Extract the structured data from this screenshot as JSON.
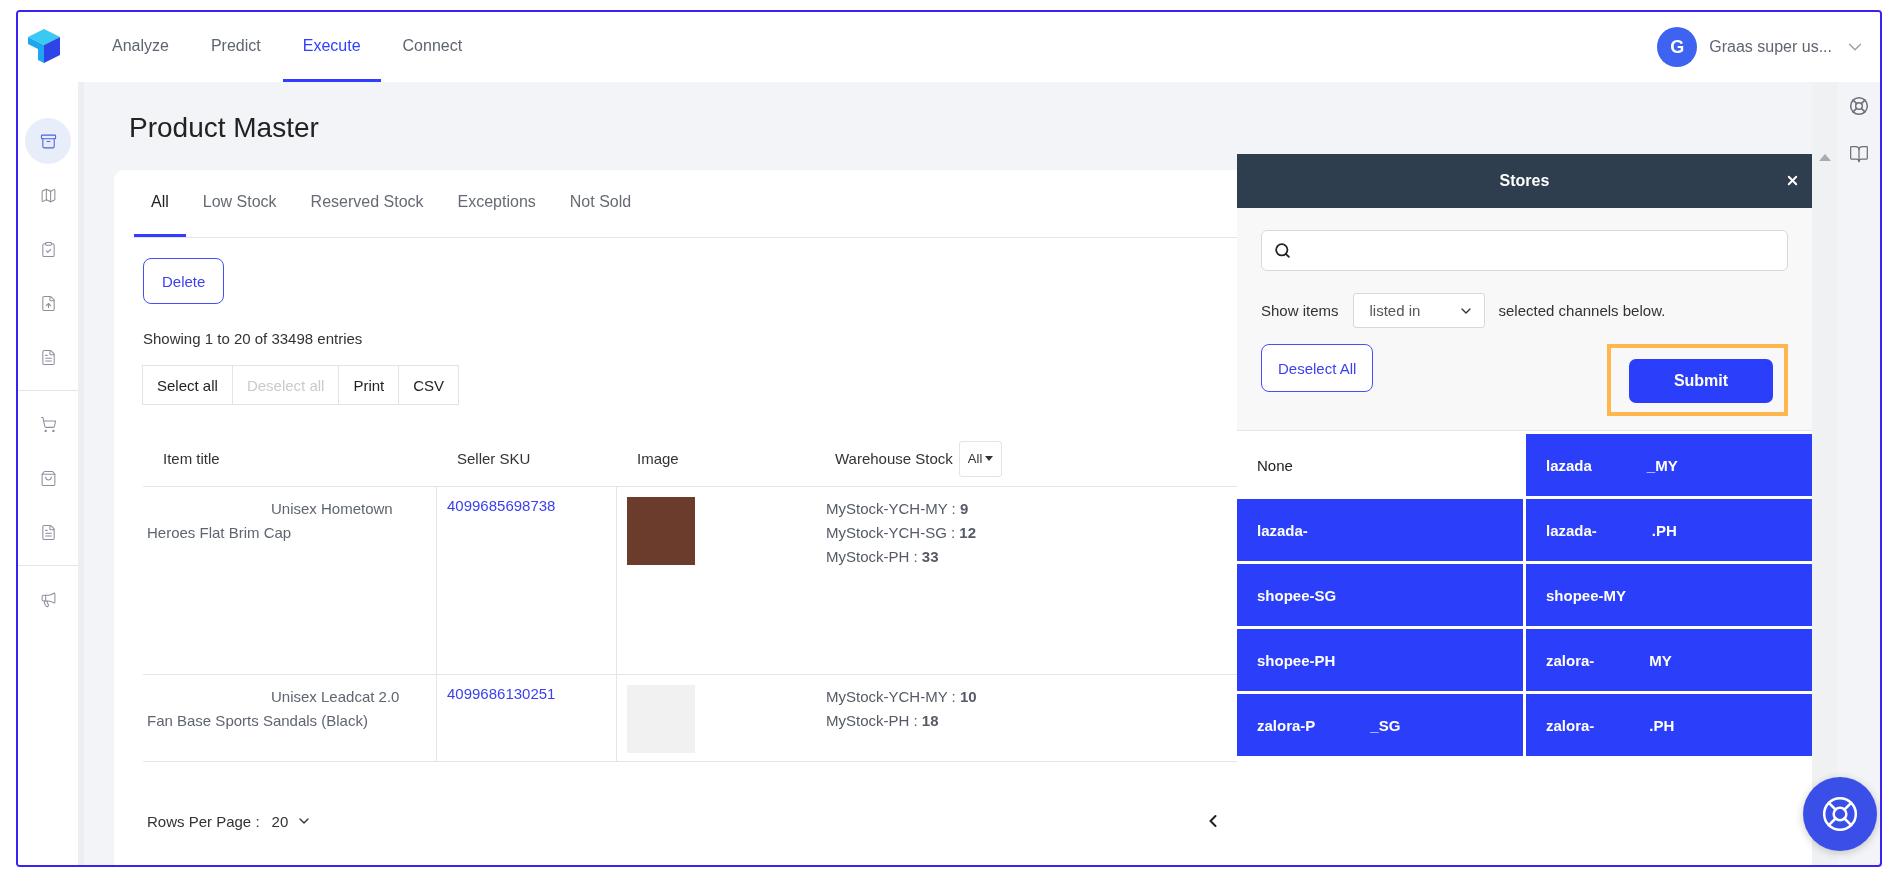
{
  "nav": {
    "items": [
      {
        "label": "Analyze",
        "selected": false
      },
      {
        "label": "Predict",
        "selected": false
      },
      {
        "label": "Execute",
        "selected": true
      },
      {
        "label": "Connect",
        "selected": false
      }
    ]
  },
  "user": {
    "initial": "G",
    "name": "Graas super us..."
  },
  "sidebar": {
    "sections": [
      {
        "items": [
          {
            "kind": "archive",
            "selected": true
          },
          {
            "kind": "map",
            "selected": false
          },
          {
            "kind": "clipboard",
            "selected": false
          },
          {
            "kind": "file-upload",
            "selected": false
          },
          {
            "kind": "document",
            "selected": false
          }
        ]
      },
      {
        "items": [
          {
            "kind": "cart",
            "selected": false
          },
          {
            "kind": "bag",
            "selected": false
          },
          {
            "kind": "document",
            "selected": false
          }
        ]
      },
      {
        "items": [
          {
            "kind": "megaphone",
            "selected": false
          }
        ]
      }
    ]
  },
  "page_title": "Product Master",
  "tabs": [
    {
      "label": "All",
      "selected": true
    },
    {
      "label": "Low Stock",
      "selected": false
    },
    {
      "label": "Reserved Stock",
      "selected": false
    },
    {
      "label": "Exceptions",
      "selected": false
    },
    {
      "label": "Not Sold",
      "selected": false
    }
  ],
  "delete_button": "Delete",
  "entries_info": "Showing 1 to 20 of 33498 entries",
  "export_buttons": [
    {
      "label": "Select all",
      "disabled": false
    },
    {
      "label": "Deselect all",
      "disabled": true
    },
    {
      "label": "Print",
      "disabled": false
    },
    {
      "label": "CSV",
      "disabled": false
    }
  ],
  "table": {
    "columns": [
      "Item title",
      "Seller SKU",
      "Image",
      "Warehouse Stock"
    ],
    "stock_filter": "All",
    "rows": [
      {
        "title": "Unisex Hometown Heroes Flat Brim Cap",
        "sku": "4099685698738",
        "stock": [
          "MyStock-YCH-MY : **9**",
          "MyStock-YCH-SG : **12**",
          "MyStock-PH : **33**"
        ]
      },
      {
        "title": "Unisex Leadcat 2.0 Fan Base Sports Sandals (Black)",
        "sku": "4099686130251",
        "stock": [
          "MyStock-YCH-MY : **10**",
          "MyStock-PH : **18**"
        ]
      }
    ]
  },
  "pagination": {
    "label": "Rows Per Page :",
    "value": "20"
  },
  "stores_panel": {
    "title": "Stores",
    "show_label": "Show items",
    "mode": "listed in",
    "suffix": "selected channels below.",
    "deselect_button": "Deselect All",
    "submit_button": "Submit",
    "submit_highlighted": true,
    "stores": [
      {
        "parts": [
          "None"
        ],
        "selected": false
      },
      {
        "parts": [
          "lazada",
          "_MY"
        ],
        "selected": true
      },
      {
        "parts": [
          "lazada-"
        ],
        "selected": true
      },
      {
        "parts": [
          "lazada-",
          ".PH"
        ],
        "selected": true
      },
      {
        "parts": [
          "shopee-SG"
        ],
        "selected": true
      },
      {
        "parts": [
          "shopee-MY"
        ],
        "selected": true
      },
      {
        "parts": [
          "shopee-PH"
        ],
        "selected": true
      },
      {
        "parts": [
          "zalora-",
          "MY"
        ],
        "selected": true
      },
      {
        "parts": [
          "zalora-P",
          "_SG"
        ],
        "selected": true
      },
      {
        "parts": [
          "zalora-",
          ".PH"
        ],
        "selected": true
      }
    ]
  }
}
